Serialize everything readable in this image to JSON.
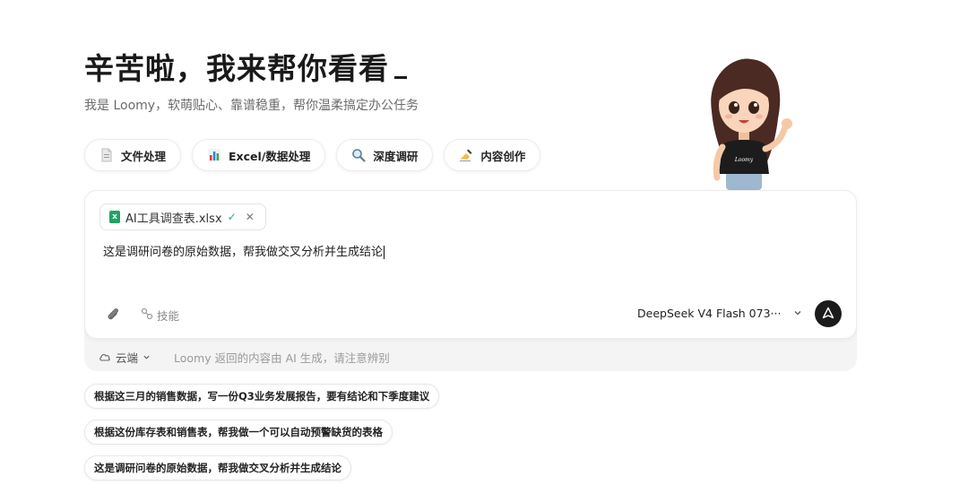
{
  "hero": {
    "title": "辛苦啦，我来帮你看看",
    "subtitle": "我是 Loomy，软萌贴心、靠谱稳重，帮你温柔搞定办公任务"
  },
  "quick_actions": [
    {
      "label": "文件处理",
      "icon": "file-icon"
    },
    {
      "label": "Excel/数据处理",
      "icon": "bar-chart-icon"
    },
    {
      "label": "深度调研",
      "icon": "magnifier-icon"
    },
    {
      "label": "内容创作",
      "icon": "writing-hand-icon"
    }
  ],
  "mascot": {
    "shirt_text": "Loomy"
  },
  "composer": {
    "attachment": {
      "filename": "AI工具调查表.xlsx",
      "status": "✓"
    },
    "input_value": "这是调研问卷的原始数据，帮我做交叉分析并生成结论",
    "skill_label": "技能",
    "model": "DeepSeek V4 Flash 073···"
  },
  "footer": {
    "mode": "云端",
    "disclaimer": "Loomy 返回的内容由 AI 生成，请注意辨别"
  },
  "suggestions": [
    "根据这三月的销售数据，写一份Q3业务发展报告，要有结论和下季度建议",
    "根据这份库存表和销售表，帮我做一个可以自动预警缺货的表格",
    "这是调研问卷的原始数据，帮我做交叉分析并生成结论"
  ],
  "colors": {
    "accent_dark": "#1b1b1b",
    "excel_green": "#21a366",
    "check_green": "#22b07d"
  }
}
